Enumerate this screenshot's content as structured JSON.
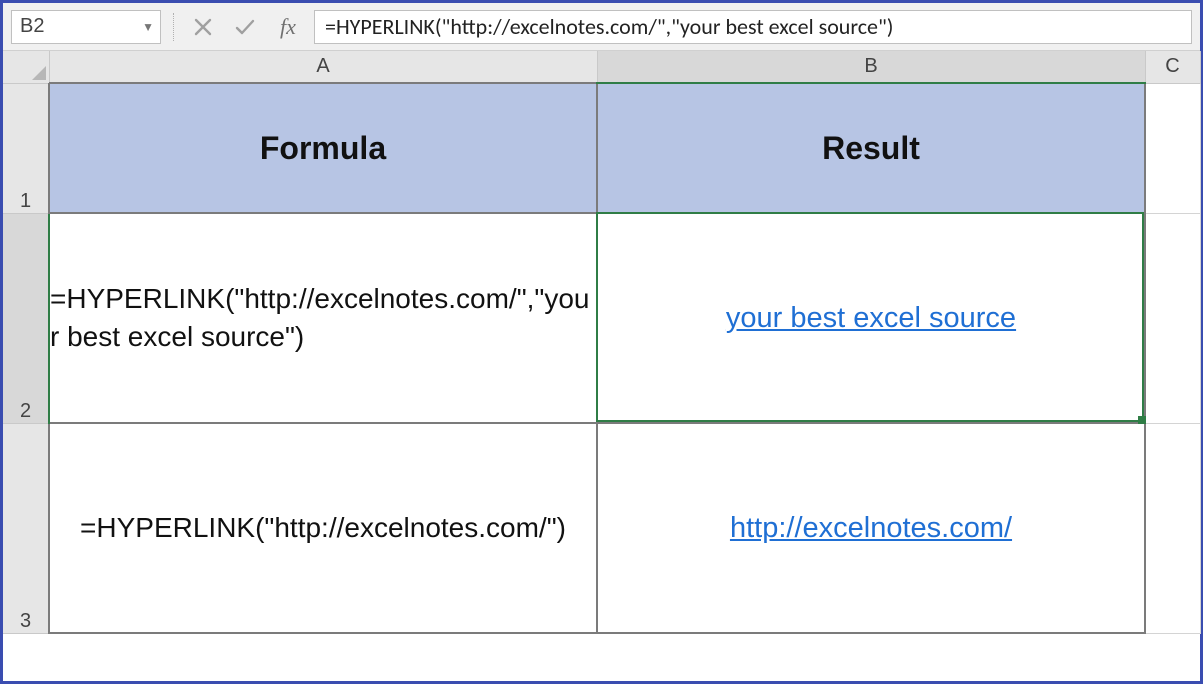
{
  "name_box": {
    "value": "B2"
  },
  "formula_bar": {
    "fx_label": "fx",
    "value": "=HYPERLINK(\"http://excelnotes.com/\",\"your best excel source\")"
  },
  "columns": {
    "a": "A",
    "b": "B",
    "c": "C"
  },
  "row_headers": {
    "r1": "1",
    "r2": "2",
    "r3": "3"
  },
  "headers": {
    "formula": "Formula",
    "result": "Result"
  },
  "rows": [
    {
      "formula": "=HYPERLINK(\"http://excelnotes.com/\",\"your best excel source\")",
      "result": "your best excel source"
    },
    {
      "formula": "=HYPERLINK(\"http://excelnotes.com/\")",
      "result": "http://excelnotes.com/"
    }
  ],
  "active_cell": "B2"
}
